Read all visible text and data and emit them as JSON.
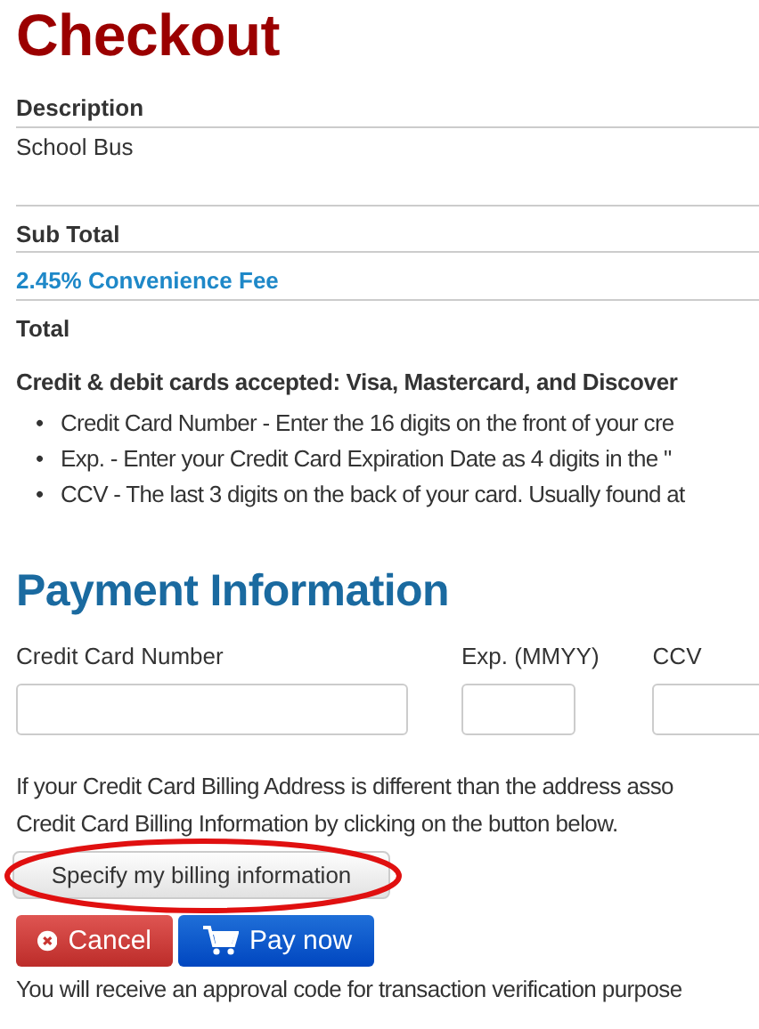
{
  "title": "Checkout",
  "summary": {
    "rows": [
      {
        "kind": "header",
        "label": "Description"
      },
      {
        "kind": "item",
        "label": "School Bus"
      },
      {
        "kind": "subtotal",
        "label": "Sub Total"
      },
      {
        "kind": "fee",
        "label": "2.45% Convenience Fee"
      },
      {
        "kind": "total",
        "label": "Total"
      }
    ]
  },
  "cards_note": {
    "heading": "Credit & debit cards accepted: Visa, Mastercard, and Discover",
    "bullets": [
      {
        "marker": "•",
        "text": "Credit Card Number - Enter the 16 digits on the front of your cre"
      },
      {
        "marker": "•",
        "text": "Exp. - Enter your Credit Card Expiration Date as 4 digits in the \""
      },
      {
        "marker": "•",
        "text": "CCV - The last 3 digits on the back of your card. Usually found at"
      }
    ]
  },
  "payment": {
    "heading": "Payment Information",
    "fields": [
      {
        "kind": "wide",
        "label": "Credit Card Number"
      },
      {
        "kind": "short",
        "label": "Exp. (MMYY)"
      },
      {
        "kind": "short",
        "label": "CCV"
      }
    ],
    "billing_note": [
      "If your Credit Card Billing Address is different than the address asso",
      "Credit Card Billing Information by clicking on the button below."
    ],
    "billing_button": {
      "label": "Specify my billing information",
      "highlighted": true
    },
    "actions": [
      {
        "kind": "cancel",
        "label": "Cancel"
      },
      {
        "kind": "pay",
        "label": "Pay now"
      }
    ],
    "footer_note": "You will receive an approval code for transaction verification purpose"
  }
}
